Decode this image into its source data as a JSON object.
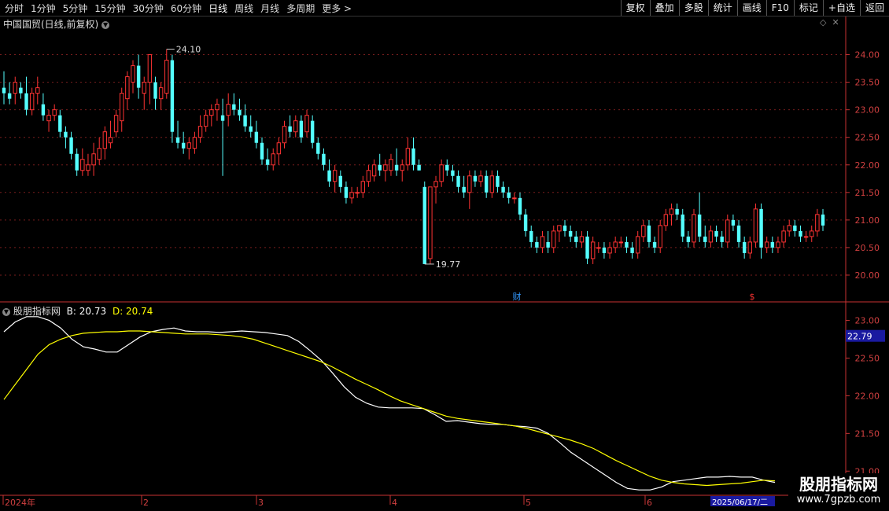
{
  "toolbar": {
    "periods": [
      "分时",
      "1分钟",
      "5分钟",
      "15分钟",
      "30分钟",
      "60分钟",
      "日线",
      "周线",
      "月线",
      "多周期",
      "更多 >"
    ],
    "active_period": "日线",
    "right_buttons": [
      "复权",
      "叠加",
      "多股",
      "统计",
      "画线",
      "F10",
      "标记",
      "+自选",
      "返回"
    ]
  },
  "main_panel": {
    "title": "中国国贸(日线,前复权)",
    "high_label": "24.10",
    "low_label": "19.77",
    "markers": [
      {
        "text": "财",
        "color": "#3399ff"
      },
      {
        "text": "$",
        "color": "#ff3333"
      }
    ]
  },
  "indicator_panel": {
    "name": "股朋指标网",
    "b_label": "B: 20.73",
    "d_label": "D: 20.74",
    "current_value": "22.79"
  },
  "date_axis": {
    "labels": [
      "2024年",
      "2",
      "3",
      "4",
      "5",
      "6"
    ],
    "current_date": "2025/06/17/二"
  },
  "watermark": {
    "line1": "股朋指标网",
    "line2": "www.7gpzb.com"
  },
  "colors": {
    "up": "#ff3333",
    "down": "#54ffff",
    "b_line": "#ffffff",
    "d_line": "#ffff00",
    "axis": "#c83232",
    "grid": "#7a1e1e"
  },
  "chart_data": [
    {
      "type": "candlestick",
      "title": "中国国贸(日线,前复权)",
      "ylim": [
        19.6,
        24.45
      ],
      "y_ticks": [
        24.0,
        23.5,
        23.0,
        22.5,
        22.0,
        21.5,
        21.0,
        20.5,
        20.0
      ],
      "x_ticks": [
        "2024年",
        "2",
        "3",
        "4",
        "5",
        "6"
      ],
      "annotations": [
        {
          "text": "24.10",
          "value": 24.1
        },
        {
          "text": "19.77",
          "value": 19.77
        }
      ],
      "ohlc": [
        [
          23.4,
          23.7,
          23.1,
          23.3
        ],
        [
          23.3,
          23.5,
          23.1,
          23.2
        ],
        [
          23.3,
          23.6,
          23.1,
          23.5
        ],
        [
          23.4,
          23.5,
          23.2,
          23.3
        ],
        [
          23.3,
          23.6,
          22.9,
          23.0
        ],
        [
          23.0,
          23.4,
          22.9,
          23.3
        ],
        [
          23.3,
          23.6,
          23.1,
          23.4
        ],
        [
          23.1,
          23.3,
          22.8,
          22.9
        ],
        [
          22.8,
          23.0,
          22.6,
          22.9
        ],
        [
          22.9,
          23.1,
          22.8,
          23.0
        ],
        [
          22.9,
          23.0,
          22.5,
          22.6
        ],
        [
          22.6,
          22.7,
          22.3,
          22.5
        ],
        [
          22.5,
          22.6,
          22.1,
          22.2
        ],
        [
          22.2,
          22.3,
          21.8,
          21.9
        ],
        [
          21.9,
          22.3,
          21.8,
          22.1
        ],
        [
          21.9,
          22.2,
          21.8,
          22.0
        ],
        [
          22.0,
          22.4,
          21.8,
          22.2
        ],
        [
          22.1,
          22.5,
          22.0,
          22.3
        ],
        [
          22.3,
          22.7,
          22.1,
          22.6
        ],
        [
          22.4,
          22.8,
          22.3,
          22.5
        ],
        [
          22.6,
          23.0,
          22.5,
          22.9
        ],
        [
          22.8,
          23.4,
          22.6,
          23.3
        ],
        [
          23.2,
          23.7,
          23.0,
          23.6
        ],
        [
          23.5,
          23.9,
          23.3,
          23.8
        ],
        [
          23.8,
          24.0,
          23.2,
          23.4
        ],
        [
          23.3,
          23.6,
          23.0,
          23.5
        ],
        [
          23.5,
          24.0,
          23.1,
          24.0
        ],
        [
          23.5,
          23.6,
          23.0,
          23.2
        ],
        [
          23.2,
          23.5,
          23.0,
          23.4
        ],
        [
          23.3,
          24.1,
          23.2,
          23.9
        ],
        [
          23.9,
          24.0,
          22.4,
          22.6
        ],
        [
          22.5,
          22.8,
          22.3,
          22.4
        ],
        [
          22.4,
          22.6,
          22.2,
          22.3
        ],
        [
          22.3,
          22.5,
          22.1,
          22.4
        ],
        [
          22.3,
          22.6,
          22.2,
          22.5
        ],
        [
          22.5,
          22.9,
          22.4,
          22.7
        ],
        [
          22.7,
          23.0,
          22.6,
          22.9
        ],
        [
          22.9,
          23.1,
          22.7,
          23.0
        ],
        [
          23.0,
          23.2,
          22.8,
          23.1
        ],
        [
          22.9,
          23.2,
          21.8,
          22.8
        ],
        [
          22.9,
          23.3,
          22.7,
          23.1
        ],
        [
          23.1,
          23.3,
          22.9,
          23.0
        ],
        [
          23.0,
          23.2,
          22.8,
          22.9
        ],
        [
          22.9,
          23.1,
          22.6,
          22.7
        ],
        [
          22.7,
          22.9,
          22.5,
          22.6
        ],
        [
          22.6,
          22.8,
          22.3,
          22.4
        ],
        [
          22.4,
          22.5,
          22.0,
          22.1
        ],
        [
          22.1,
          22.3,
          21.9,
          22.0
        ],
        [
          22.0,
          22.3,
          21.9,
          22.2
        ],
        [
          22.2,
          22.5,
          22.0,
          22.4
        ],
        [
          22.4,
          22.8,
          22.3,
          22.7
        ],
        [
          22.7,
          22.9,
          22.5,
          22.6
        ],
        [
          22.6,
          22.9,
          22.5,
          22.8
        ],
        [
          22.8,
          22.9,
          22.4,
          22.5
        ],
        [
          22.6,
          23.0,
          22.5,
          22.9
        ],
        [
          22.8,
          22.9,
          22.3,
          22.4
        ],
        [
          22.4,
          22.5,
          22.1,
          22.2
        ],
        [
          22.2,
          22.3,
          21.9,
          22.0
        ],
        [
          21.9,
          22.1,
          21.6,
          21.7
        ],
        [
          21.7,
          22.0,
          21.5,
          21.9
        ],
        [
          21.8,
          21.9,
          21.5,
          21.6
        ],
        [
          21.6,
          21.7,
          21.3,
          21.4
        ],
        [
          21.4,
          21.6,
          21.3,
          21.5
        ],
        [
          21.5,
          21.6,
          21.4,
          21.5
        ],
        [
          21.5,
          21.8,
          21.4,
          21.7
        ],
        [
          21.7,
          22.0,
          21.6,
          21.9
        ],
        [
          21.8,
          22.1,
          21.7,
          22.0
        ],
        [
          22.0,
          22.2,
          21.8,
          21.9
        ],
        [
          21.9,
          22.1,
          21.7,
          22.0
        ],
        [
          21.9,
          22.2,
          21.8,
          22.1
        ],
        [
          22.0,
          22.3,
          21.8,
          21.9
        ],
        [
          21.9,
          22.1,
          21.7,
          22.0
        ],
        [
          22.0,
          22.5,
          21.9,
          22.3
        ],
        [
          22.3,
          22.5,
          21.9,
          22.0
        ],
        [
          22.0,
          22.1,
          21.9,
          21.9
        ],
        [
          21.6,
          21.7,
          20.2,
          20.2
        ],
        [
          20.3,
          21.6,
          20.2,
          21.6
        ],
        [
          21.6,
          21.8,
          21.3,
          21.7
        ],
        [
          21.7,
          22.1,
          21.6,
          22.0
        ],
        [
          22.0,
          22.1,
          21.8,
          21.9
        ],
        [
          21.9,
          22.0,
          21.7,
          21.8
        ],
        [
          21.8,
          21.9,
          21.5,
          21.6
        ],
        [
          21.6,
          21.8,
          21.4,
          21.5
        ],
        [
          21.5,
          21.9,
          21.2,
          21.8
        ],
        [
          21.8,
          21.9,
          21.6,
          21.7
        ],
        [
          21.7,
          21.9,
          21.6,
          21.8
        ],
        [
          21.8,
          21.9,
          21.4,
          21.5
        ],
        [
          21.5,
          21.9,
          21.4,
          21.8
        ],
        [
          21.8,
          21.9,
          21.5,
          21.6
        ],
        [
          21.6,
          21.7,
          21.4,
          21.5
        ],
        [
          21.5,
          21.6,
          21.3,
          21.4
        ],
        [
          21.4,
          21.5,
          21.3,
          21.4
        ],
        [
          21.4,
          21.5,
          21.0,
          21.1
        ],
        [
          21.1,
          21.2,
          20.7,
          20.8
        ],
        [
          20.8,
          20.9,
          20.5,
          20.6
        ],
        [
          20.6,
          20.7,
          20.4,
          20.5
        ],
        [
          20.5,
          20.8,
          20.4,
          20.7
        ],
        [
          20.6,
          20.8,
          20.4,
          20.5
        ],
        [
          20.5,
          20.9,
          20.4,
          20.8
        ],
        [
          20.8,
          20.9,
          20.6,
          20.9
        ],
        [
          20.9,
          21.0,
          20.7,
          20.8
        ],
        [
          20.8,
          20.9,
          20.6,
          20.7
        ],
        [
          20.7,
          20.8,
          20.5,
          20.6
        ],
        [
          20.6,
          20.8,
          20.5,
          20.7
        ],
        [
          20.7,
          20.8,
          20.2,
          20.3
        ],
        [
          20.3,
          20.7,
          20.2,
          20.6
        ],
        [
          20.5,
          20.6,
          20.4,
          20.5
        ],
        [
          20.5,
          20.6,
          20.3,
          20.4
        ],
        [
          20.4,
          20.6,
          20.3,
          20.5
        ],
        [
          20.5,
          20.7,
          20.4,
          20.6
        ],
        [
          20.6,
          20.7,
          20.5,
          20.6
        ],
        [
          20.6,
          20.7,
          20.4,
          20.5
        ],
        [
          20.5,
          20.6,
          20.3,
          20.4
        ],
        [
          20.4,
          20.8,
          20.3,
          20.7
        ],
        [
          20.7,
          21.0,
          20.6,
          20.9
        ],
        [
          20.9,
          21.0,
          20.5,
          20.6
        ],
        [
          20.6,
          20.7,
          20.4,
          20.5
        ],
        [
          20.5,
          21.0,
          20.4,
          20.9
        ],
        [
          20.9,
          21.2,
          20.8,
          21.1
        ],
        [
          21.1,
          21.3,
          20.9,
          21.2
        ],
        [
          21.2,
          21.3,
          21.0,
          21.1
        ],
        [
          21.1,
          21.2,
          20.6,
          20.7
        ],
        [
          20.7,
          20.8,
          20.5,
          20.6
        ],
        [
          20.6,
          21.2,
          20.5,
          21.1
        ],
        [
          21.1,
          21.5,
          20.6,
          20.7
        ],
        [
          20.7,
          20.9,
          20.5,
          20.6
        ],
        [
          20.6,
          20.9,
          20.5,
          20.8
        ],
        [
          20.8,
          20.9,
          20.6,
          20.7
        ],
        [
          20.7,
          20.8,
          20.5,
          20.6
        ],
        [
          20.6,
          21.1,
          20.5,
          21.0
        ],
        [
          21.0,
          21.1,
          20.8,
          20.9
        ],
        [
          20.9,
          21.0,
          20.5,
          20.6
        ],
        [
          20.6,
          20.7,
          20.3,
          20.4
        ],
        [
          20.4,
          20.7,
          20.3,
          20.6
        ],
        [
          20.6,
          21.3,
          20.5,
          21.2
        ],
        [
          21.2,
          21.3,
          20.3,
          20.5
        ],
        [
          20.5,
          20.7,
          20.4,
          20.6
        ],
        [
          20.6,
          20.7,
          20.4,
          20.5
        ],
        [
          20.5,
          20.7,
          20.4,
          20.6
        ],
        [
          20.6,
          20.9,
          20.5,
          20.8
        ],
        [
          20.8,
          21.0,
          20.7,
          20.9
        ],
        [
          20.9,
          21.0,
          20.7,
          20.8
        ],
        [
          20.8,
          20.9,
          20.6,
          20.7
        ],
        [
          20.7,
          20.8,
          20.6,
          20.7
        ],
        [
          20.7,
          20.9,
          20.6,
          20.8
        ],
        [
          20.8,
          21.2,
          20.7,
          21.1
        ],
        [
          21.1,
          21.2,
          20.8,
          20.9
        ]
      ]
    },
    {
      "type": "line",
      "title": "股朋指标网",
      "ylim": [
        20.7,
        23.1
      ],
      "y_ticks": [
        23.0,
        22.5,
        22.0,
        21.5,
        21.0
      ],
      "series": [
        {
          "name": "B",
          "color": "#ffffff",
          "values": [
            22.85,
            22.98,
            23.05,
            23.05,
            23.0,
            22.9,
            22.75,
            22.65,
            22.62,
            22.58,
            22.58,
            22.68,
            22.78,
            22.85,
            22.88,
            22.9,
            22.86,
            22.85,
            22.85,
            22.84,
            22.85,
            22.86,
            22.85,
            22.84,
            22.82,
            22.8,
            22.72,
            22.6,
            22.47,
            22.3,
            22.12,
            21.98,
            21.9,
            21.85,
            21.84,
            21.84,
            21.84,
            21.83,
            21.75,
            21.66,
            21.67,
            21.65,
            21.63,
            21.62,
            21.62,
            21.6,
            21.59,
            21.57,
            21.5,
            21.38,
            21.25,
            21.15,
            21.05,
            20.95,
            20.85,
            20.77,
            20.75,
            20.75,
            20.79,
            20.86,
            20.88,
            20.9,
            20.92,
            20.92,
            20.93,
            20.92,
            20.92,
            20.88,
            20.85
          ]
        },
        {
          "name": "D",
          "color": "#ffff00",
          "values": [
            21.95,
            22.15,
            22.35,
            22.55,
            22.68,
            22.75,
            22.8,
            22.83,
            22.84,
            22.85,
            22.85,
            22.86,
            22.86,
            22.85,
            22.84,
            22.83,
            22.82,
            22.82,
            22.82,
            22.81,
            22.8,
            22.78,
            22.75,
            22.7,
            22.65,
            22.6,
            22.55,
            22.5,
            22.45,
            22.38,
            22.3,
            22.22,
            22.15,
            22.08,
            22.0,
            21.93,
            21.88,
            21.83,
            21.78,
            21.73,
            21.7,
            21.68,
            21.66,
            21.64,
            21.62,
            21.6,
            21.57,
            21.53,
            21.49,
            21.45,
            21.41,
            21.36,
            21.3,
            21.22,
            21.14,
            21.07,
            21.0,
            20.93,
            20.88,
            20.85,
            20.83,
            20.82,
            20.81,
            20.82,
            20.83,
            20.84,
            20.86,
            20.88,
            20.87
          ]
        }
      ]
    }
  ]
}
